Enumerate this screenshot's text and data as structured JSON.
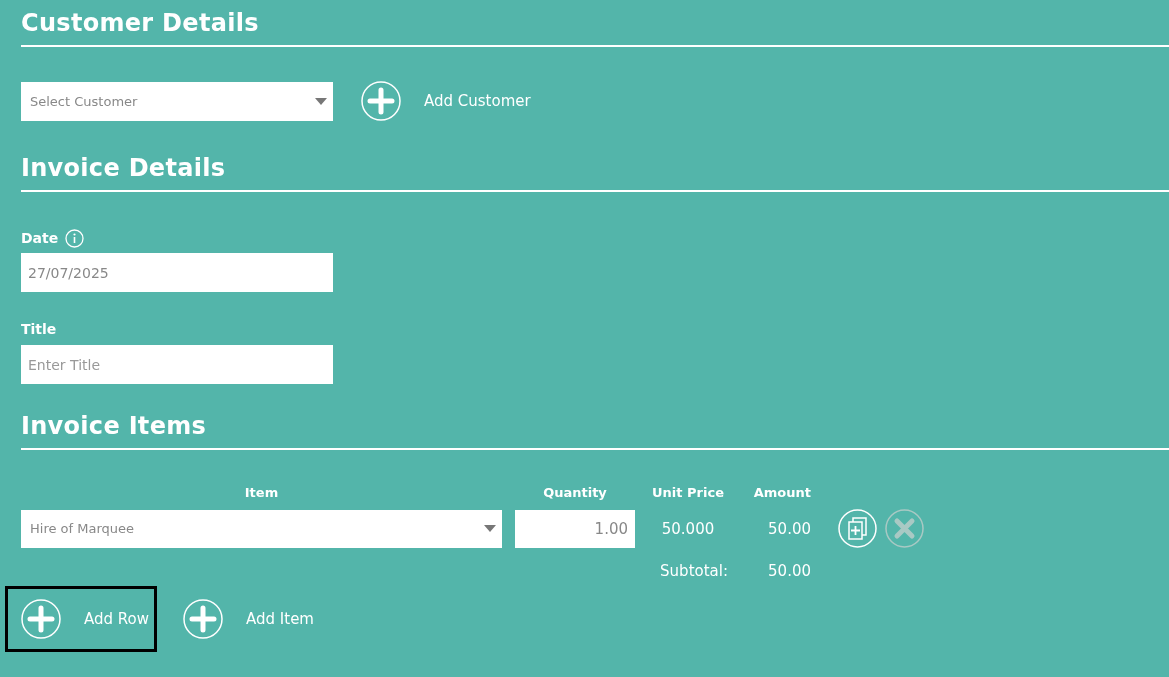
{
  "customer_details": {
    "heading": "Customer Details",
    "customer_select": {
      "placeholder": "Select Customer"
    },
    "add_customer_button": {
      "label": "Add Customer"
    }
  },
  "invoice_details": {
    "heading": "Invoice Details",
    "date": {
      "label": "Date",
      "value": "27/07/2025"
    },
    "title": {
      "label": "Title",
      "placeholder": "Enter Title"
    }
  },
  "invoice_items": {
    "heading": "Invoice Items",
    "columns": [
      "Item",
      "Quantity",
      "Unit Price",
      "Amount"
    ],
    "rows": [
      {
        "item": "Hire of Marquee",
        "quantity": "1.00",
        "unit_price": "50.000",
        "amount": "50.00",
        "delete_disabled": true
      }
    ],
    "subtotal": {
      "label": "Subtotal:",
      "value": "50.00"
    },
    "add_row_button": {
      "label": "Add Row",
      "focused": true
    },
    "add_item_button": {
      "label": "Add Item",
      "focused": false
    }
  }
}
